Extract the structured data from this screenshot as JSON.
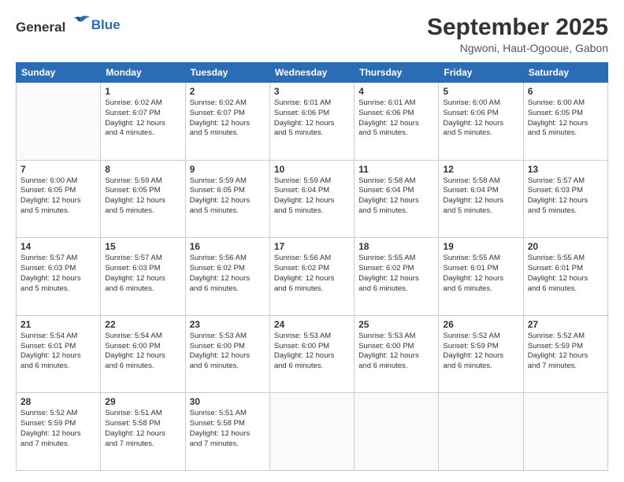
{
  "header": {
    "logo_general": "General",
    "logo_blue": "Blue",
    "month_title": "September 2025",
    "location": "Ngwoni, Haut-Ogooue, Gabon"
  },
  "weekdays": [
    "Sunday",
    "Monday",
    "Tuesday",
    "Wednesday",
    "Thursday",
    "Friday",
    "Saturday"
  ],
  "weeks": [
    [
      {
        "day": "",
        "info": ""
      },
      {
        "day": "1",
        "info": "Sunrise: 6:02 AM\nSunset: 6:07 PM\nDaylight: 12 hours\nand 4 minutes."
      },
      {
        "day": "2",
        "info": "Sunrise: 6:02 AM\nSunset: 6:07 PM\nDaylight: 12 hours\nand 5 minutes."
      },
      {
        "day": "3",
        "info": "Sunrise: 6:01 AM\nSunset: 6:06 PM\nDaylight: 12 hours\nand 5 minutes."
      },
      {
        "day": "4",
        "info": "Sunrise: 6:01 AM\nSunset: 6:06 PM\nDaylight: 12 hours\nand 5 minutes."
      },
      {
        "day": "5",
        "info": "Sunrise: 6:00 AM\nSunset: 6:06 PM\nDaylight: 12 hours\nand 5 minutes."
      },
      {
        "day": "6",
        "info": "Sunrise: 6:00 AM\nSunset: 6:05 PM\nDaylight: 12 hours\nand 5 minutes."
      }
    ],
    [
      {
        "day": "7",
        "info": "Sunrise: 6:00 AM\nSunset: 6:05 PM\nDaylight: 12 hours\nand 5 minutes."
      },
      {
        "day": "8",
        "info": "Sunrise: 5:59 AM\nSunset: 6:05 PM\nDaylight: 12 hours\nand 5 minutes."
      },
      {
        "day": "9",
        "info": "Sunrise: 5:59 AM\nSunset: 6:05 PM\nDaylight: 12 hours\nand 5 minutes."
      },
      {
        "day": "10",
        "info": "Sunrise: 5:59 AM\nSunset: 6:04 PM\nDaylight: 12 hours\nand 5 minutes."
      },
      {
        "day": "11",
        "info": "Sunrise: 5:58 AM\nSunset: 6:04 PM\nDaylight: 12 hours\nand 5 minutes."
      },
      {
        "day": "12",
        "info": "Sunrise: 5:58 AM\nSunset: 6:04 PM\nDaylight: 12 hours\nand 5 minutes."
      },
      {
        "day": "13",
        "info": "Sunrise: 5:57 AM\nSunset: 6:03 PM\nDaylight: 12 hours\nand 5 minutes."
      }
    ],
    [
      {
        "day": "14",
        "info": "Sunrise: 5:57 AM\nSunset: 6:03 PM\nDaylight: 12 hours\nand 5 minutes."
      },
      {
        "day": "15",
        "info": "Sunrise: 5:57 AM\nSunset: 6:03 PM\nDaylight: 12 hours\nand 6 minutes."
      },
      {
        "day": "16",
        "info": "Sunrise: 5:56 AM\nSunset: 6:02 PM\nDaylight: 12 hours\nand 6 minutes."
      },
      {
        "day": "17",
        "info": "Sunrise: 5:56 AM\nSunset: 6:02 PM\nDaylight: 12 hours\nand 6 minutes."
      },
      {
        "day": "18",
        "info": "Sunrise: 5:55 AM\nSunset: 6:02 PM\nDaylight: 12 hours\nand 6 minutes."
      },
      {
        "day": "19",
        "info": "Sunrise: 5:55 AM\nSunset: 6:01 PM\nDaylight: 12 hours\nand 6 minutes."
      },
      {
        "day": "20",
        "info": "Sunrise: 5:55 AM\nSunset: 6:01 PM\nDaylight: 12 hours\nand 6 minutes."
      }
    ],
    [
      {
        "day": "21",
        "info": "Sunrise: 5:54 AM\nSunset: 6:01 PM\nDaylight: 12 hours\nand 6 minutes."
      },
      {
        "day": "22",
        "info": "Sunrise: 5:54 AM\nSunset: 6:00 PM\nDaylight: 12 hours\nand 6 minutes."
      },
      {
        "day": "23",
        "info": "Sunrise: 5:53 AM\nSunset: 6:00 PM\nDaylight: 12 hours\nand 6 minutes."
      },
      {
        "day": "24",
        "info": "Sunrise: 5:53 AM\nSunset: 6:00 PM\nDaylight: 12 hours\nand 6 minutes."
      },
      {
        "day": "25",
        "info": "Sunrise: 5:53 AM\nSunset: 6:00 PM\nDaylight: 12 hours\nand 6 minutes."
      },
      {
        "day": "26",
        "info": "Sunrise: 5:52 AM\nSunset: 5:59 PM\nDaylight: 12 hours\nand 6 minutes."
      },
      {
        "day": "27",
        "info": "Sunrise: 5:52 AM\nSunset: 5:59 PM\nDaylight: 12 hours\nand 7 minutes."
      }
    ],
    [
      {
        "day": "28",
        "info": "Sunrise: 5:52 AM\nSunset: 5:59 PM\nDaylight: 12 hours\nand 7 minutes."
      },
      {
        "day": "29",
        "info": "Sunrise: 5:51 AM\nSunset: 5:58 PM\nDaylight: 12 hours\nand 7 minutes."
      },
      {
        "day": "30",
        "info": "Sunrise: 5:51 AM\nSunset: 5:58 PM\nDaylight: 12 hours\nand 7 minutes."
      },
      {
        "day": "",
        "info": ""
      },
      {
        "day": "",
        "info": ""
      },
      {
        "day": "",
        "info": ""
      },
      {
        "day": "",
        "info": ""
      }
    ]
  ]
}
